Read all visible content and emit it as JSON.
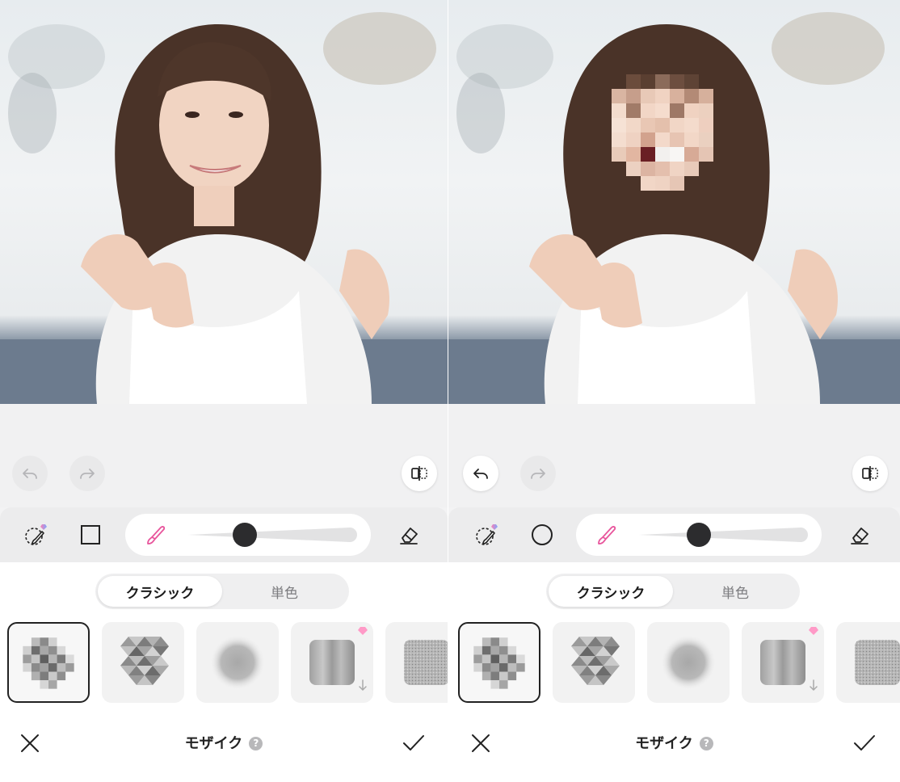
{
  "panels": [
    {
      "id": "before",
      "face_pixelated": false,
      "undo_active": false,
      "redo_active": false,
      "shape_tool": "square",
      "brush_size": 0.33,
      "segment": {
        "selected": "クラシック",
        "other": "単色"
      },
      "effects": [
        {
          "name": "mosaic-classic",
          "selected": true
        },
        {
          "name": "mosaic-triangle",
          "selected": false
        },
        {
          "name": "blur",
          "selected": false
        },
        {
          "name": "streak",
          "selected": false,
          "premium": true,
          "download": true
        },
        {
          "name": "noise",
          "selected": false
        }
      ],
      "footer": {
        "title": "モザイク",
        "help": "?"
      }
    },
    {
      "id": "after",
      "face_pixelated": true,
      "undo_active": true,
      "redo_active": false,
      "shape_tool": "circle",
      "brush_size": 0.35,
      "segment": {
        "selected": "クラシック",
        "other": "単色"
      },
      "effects": [
        {
          "name": "mosaic-classic",
          "selected": true
        },
        {
          "name": "mosaic-triangle",
          "selected": false
        },
        {
          "name": "blur",
          "selected": false
        },
        {
          "name": "streak",
          "selected": false,
          "premium": true,
          "download": true
        },
        {
          "name": "noise",
          "selected": false
        }
      ],
      "footer": {
        "title": "モザイク",
        "help": "?"
      }
    }
  ],
  "colors": {
    "accent_brush": "#e8559c",
    "premium_badge_start": "#ff7eb3",
    "premium_badge_end": "#7aa7ff",
    "knob": "#2c2c2e",
    "icon_dark": "#222222",
    "icon_disabled": "#b5b5b8"
  },
  "icons": {
    "undo": "undo-arrow-icon",
    "redo": "redo-arrow-icon",
    "compare": "compare-split-icon",
    "lasso_brush": "lasso-brush-icon",
    "square": "square-shape-icon",
    "circle": "circle-shape-icon",
    "brush": "paint-brush-icon",
    "eraser": "eraser-icon",
    "close": "close-x-icon",
    "apply": "checkmark-icon"
  }
}
